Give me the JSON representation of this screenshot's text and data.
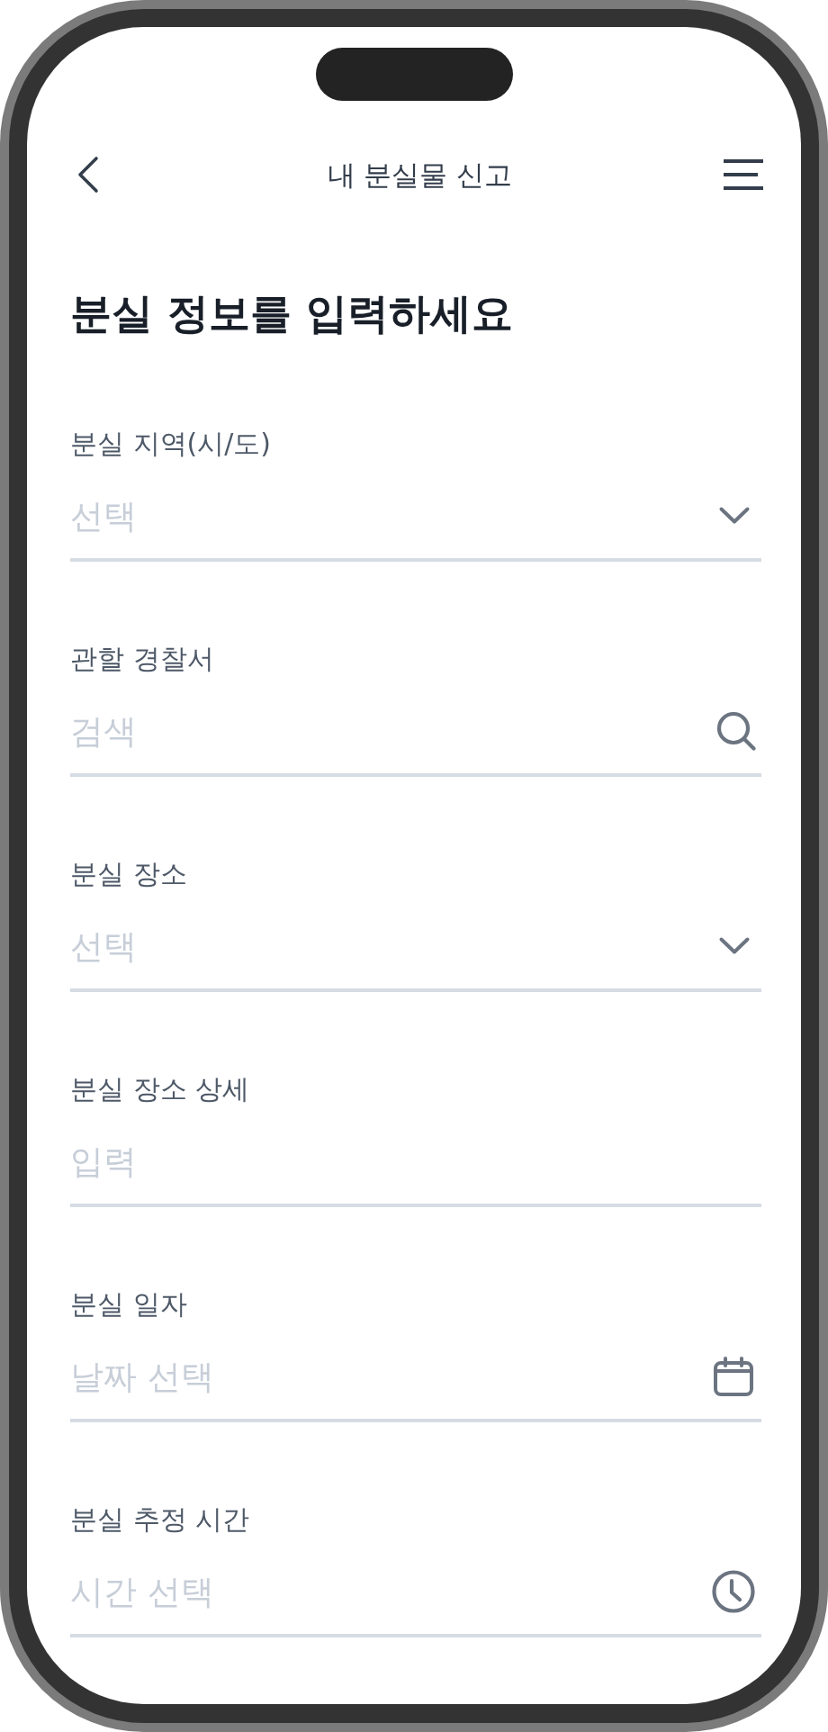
{
  "header": {
    "title": "내 분실물 신고"
  },
  "heading": "분실 정보를 입력하세요",
  "fields": [
    {
      "kind": "select",
      "label": "분실 지역(시/도)",
      "placeholder": "선택"
    },
    {
      "kind": "search",
      "label": "관할 경찰서",
      "placeholder": "검색"
    },
    {
      "kind": "select",
      "label": "분실 장소",
      "placeholder": "선택"
    },
    {
      "kind": "text",
      "label": "분실 장소 상세",
      "placeholder": "입력"
    },
    {
      "kind": "date",
      "label": "분실 일자",
      "placeholder": "날짜 선택"
    },
    {
      "kind": "time",
      "label": "분실 추정 시간",
      "placeholder": "시간 선택"
    }
  ]
}
